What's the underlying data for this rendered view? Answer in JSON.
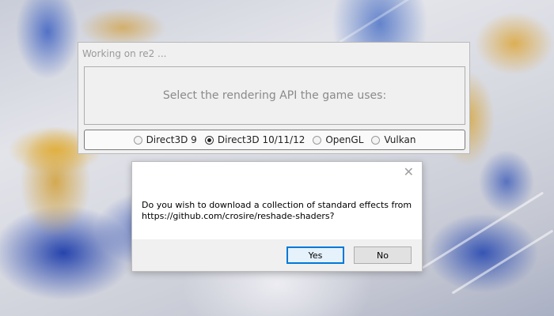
{
  "main_window": {
    "title": "Working on re2 ...",
    "message": "Select the rendering API the game uses:",
    "api_options": [
      {
        "label": "Direct3D 9",
        "checked": false
      },
      {
        "label": "Direct3D 10/11/12",
        "checked": true
      },
      {
        "label": "OpenGL",
        "checked": false
      },
      {
        "label": "Vulkan",
        "checked": false
      }
    ]
  },
  "dialog": {
    "close_icon": "close-icon",
    "message_line1": "Do you wish to download a collection of standard effects from",
    "message_line2": "https://github.com/crosire/reshade-shaders?",
    "yes_label": "Yes",
    "no_label": "No"
  }
}
